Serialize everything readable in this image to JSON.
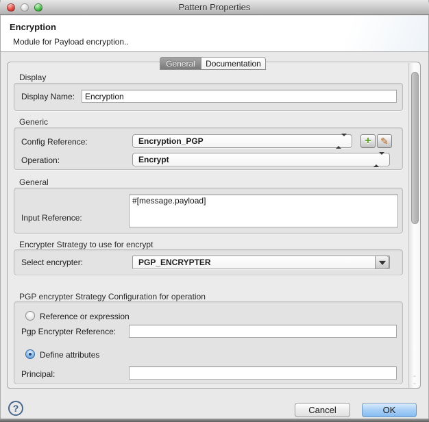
{
  "colors": {
    "accent_blue": "#4c86c4",
    "ok_button_blue": "#85bcf1",
    "selected_tab_gray": "#7a7a7a",
    "add_icon_green": "#58a01e",
    "edit_icon_orange": "#b5651d",
    "help_icon_blue": "#3e5f88"
  },
  "titlebar": {
    "title": "Pattern Properties"
  },
  "header": {
    "title": "Encryption",
    "subtitle": "Module for Payload encryption.."
  },
  "tabs": [
    {
      "label": "General",
      "selected": true
    },
    {
      "label": "Documentation",
      "selected": false
    }
  ],
  "sections": {
    "display": {
      "legend": "Display",
      "display_name_label": "Display Name:",
      "display_name_value": "Encryption"
    },
    "generic": {
      "legend": "Generic",
      "config_reference_label": "Config Reference:",
      "config_reference_value": "Encryption_PGP",
      "operation_label": "Operation:",
      "operation_value": "Encrypt"
    },
    "general": {
      "legend": "General",
      "input_reference_label": "Input Reference:",
      "input_reference_value": "#[message.payload]"
    },
    "encrypter_strategy": {
      "legend": "Encrypter Strategy to use for encrypt",
      "select_encrypter_label": "Select encrypter:",
      "select_encrypter_value": "PGP_ENCRYPTER"
    },
    "pgp": {
      "legend": "PGP encrypter Strategy Configuration for operation",
      "reference_radio_label": "Reference or expression",
      "reference_radio_selected": false,
      "pgp_encrypter_reference_label": "Pgp Encrypter Reference:",
      "pgp_encrypter_reference_value": "",
      "define_radio_label": "Define attributes",
      "define_radio_selected": true,
      "principal_label": "Principal:",
      "principal_value": ""
    }
  },
  "icons": {
    "add": "+",
    "edit": "✎",
    "help": "?"
  },
  "footer": {
    "cancel_label": "Cancel",
    "ok_label": "OK"
  }
}
